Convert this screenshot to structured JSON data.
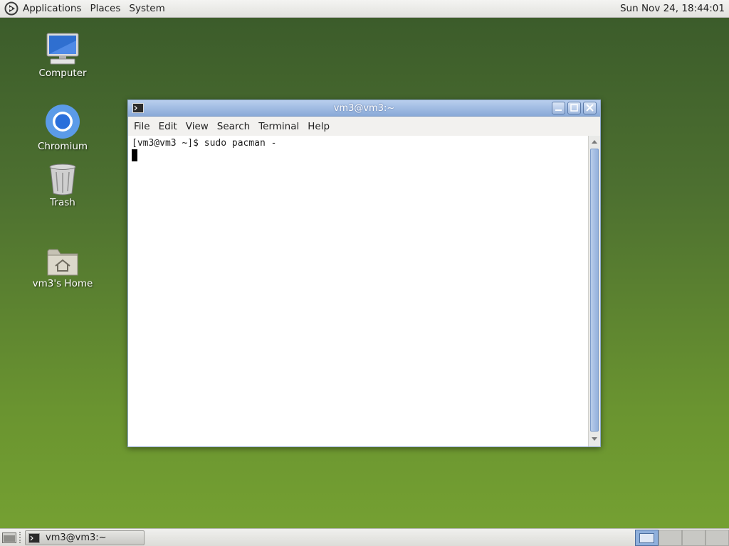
{
  "top_panel": {
    "applications": "Applications",
    "places": "Places",
    "system": "System",
    "clock": "Sun Nov 24, 18:44:01"
  },
  "desktop": {
    "icons": [
      {
        "label": "Computer",
        "icon": "computer-icon"
      },
      {
        "label": "Chromium",
        "icon": "chromium-icon"
      },
      {
        "label": "Trash",
        "icon": "trash-icon"
      },
      {
        "label": "vm3's Home",
        "icon": "home-folder-icon"
      }
    ]
  },
  "window": {
    "title": "vm3@vm3:~",
    "menu": [
      "File",
      "Edit",
      "View",
      "Search",
      "Terminal",
      "Help"
    ],
    "terminal_line": "[vm3@vm3 ~]$ sudo pacman -"
  },
  "bottom_panel": {
    "task_label": "vm3@vm3:~",
    "workspaces": 4,
    "active_workspace": 1
  },
  "colors": {
    "title_bar": "#89a9d8",
    "desktop_top": "#3a5a2a",
    "desktop_bottom": "#76a232",
    "active_workspace": "#8fb0dc"
  }
}
